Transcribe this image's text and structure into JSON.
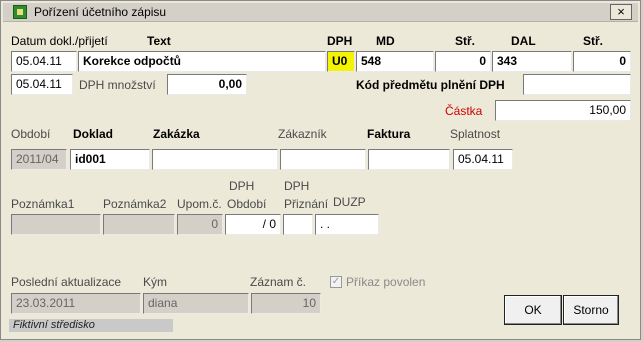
{
  "window": {
    "title": "Pořízení účetního zápisu",
    "close_glyph": "×"
  },
  "header": {
    "datum_label": "Datum dokl./přijetí",
    "text_label": "Text",
    "dph_label": "DPH",
    "md_label": "MD",
    "str_label": "Stř.",
    "dal_label": "DAL",
    "str2_label": "Stř."
  },
  "row1": {
    "date": "05.04.11",
    "text": "Korekce odpočtů",
    "dph": "U0",
    "md": "548",
    "md_str": "0",
    "dal": "343",
    "dal_str": "0"
  },
  "row2": {
    "date": "05.04.11",
    "dph_mnozstvi_label": "DPH množství",
    "dph_mnozstvi": "0,00",
    "kod_label": "Kód předmětu plnění DPH",
    "kod_value": ""
  },
  "amount": {
    "label": "Částka",
    "value": "150,00"
  },
  "doc": {
    "obdobi_label": "Období",
    "doklad_label": "Doklad",
    "zakazka_label": "Zakázka",
    "zakaznik_label": "Zákazník",
    "faktura_label": "Faktura",
    "splatnost_label": "Splatnost",
    "obdobi": "2011/04",
    "doklad": "id001",
    "zakazka": "",
    "zakaznik": "",
    "faktura": "",
    "splatnost": "05.04.11"
  },
  "notes": {
    "poz1_label": "Poznámka1",
    "poz2_label": "Poznámka2",
    "upom_label": "Upom.č.",
    "dph_obdobi_label_1": "DPH",
    "dph_obdobi_label_2": "Období",
    "dph_priznani_label_1": "DPH",
    "dph_priznani_label_2": "Přiznání",
    "duzp_label": "DUZP",
    "upom": "0",
    "dph_obdobi": "/ 0",
    "duzp": ". ."
  },
  "footer": {
    "posledni_label": "Poslední aktualizace",
    "kym_label": "Kým",
    "zaznam_label": "Záznam č.",
    "posledni": "23.03.2011",
    "kym": "diana",
    "zaznam": "10",
    "prikaz_label": "Příkaz povolen",
    "ok_label": "OK",
    "storno_label": "Storno",
    "status": "Fiktivní středisko"
  }
}
